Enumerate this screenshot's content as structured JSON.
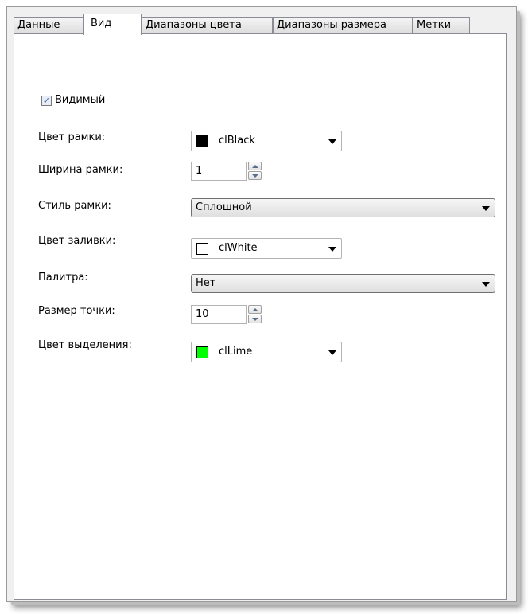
{
  "tabs": [
    {
      "label": "Данные"
    },
    {
      "label": "Вид"
    },
    {
      "label": "Диапазоны цвета"
    },
    {
      "label": "Диапазоны размера"
    },
    {
      "label": "Метки"
    }
  ],
  "visible": {
    "label": "Видимый",
    "checked": true
  },
  "form": {
    "border_color": {
      "label": "Цвет рамки:",
      "value": "clBlack",
      "swatch": "#000000"
    },
    "border_width": {
      "label": "Ширина рамки:",
      "value": "1"
    },
    "border_style": {
      "label": "Стиль рамки:",
      "value": "Сплошной"
    },
    "fill_color": {
      "label": "Цвет заливки:",
      "value": "clWhite",
      "swatch": "#ffffff"
    },
    "palette": {
      "label": "Палитра:",
      "value": "Нет"
    },
    "point_size": {
      "label": "Размер точки:",
      "value": "10"
    },
    "highlight_color": {
      "label": "Цвет выделения:",
      "value": "clLime",
      "swatch": "#00ff00"
    }
  }
}
